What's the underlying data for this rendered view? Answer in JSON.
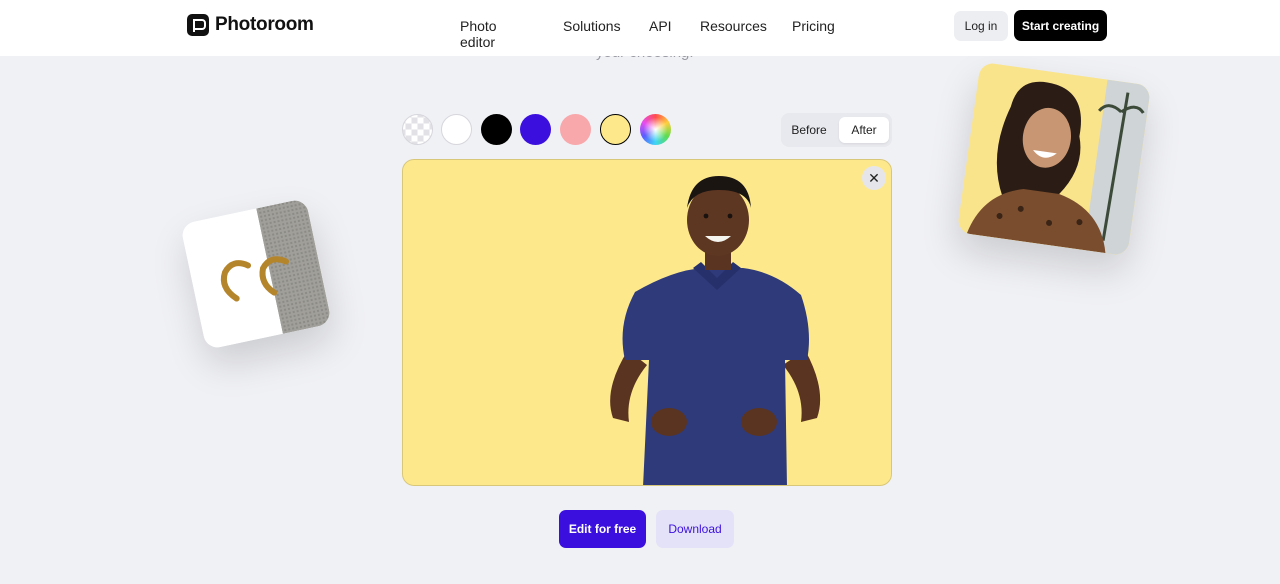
{
  "header": {
    "brand": "Photoroom",
    "nav": [
      "Photo editor",
      "Solutions",
      "API",
      "Resources",
      "Pricing"
    ],
    "login_label": "Log in",
    "start_label": "Start creating"
  },
  "hero": {
    "cut_text": "your choosing."
  },
  "swatches": {
    "colors": [
      "#ffffff",
      "#000000",
      "#3b10de",
      "#f8a7ab",
      "#fde98c"
    ],
    "selected": "#fde98c"
  },
  "toggle": {
    "before_label": "Before",
    "after_label": "After",
    "selected": "After"
  },
  "editor": {
    "background_color": "#fde98c"
  },
  "actions": {
    "edit_label": "Edit for free",
    "download_label": "Download"
  }
}
